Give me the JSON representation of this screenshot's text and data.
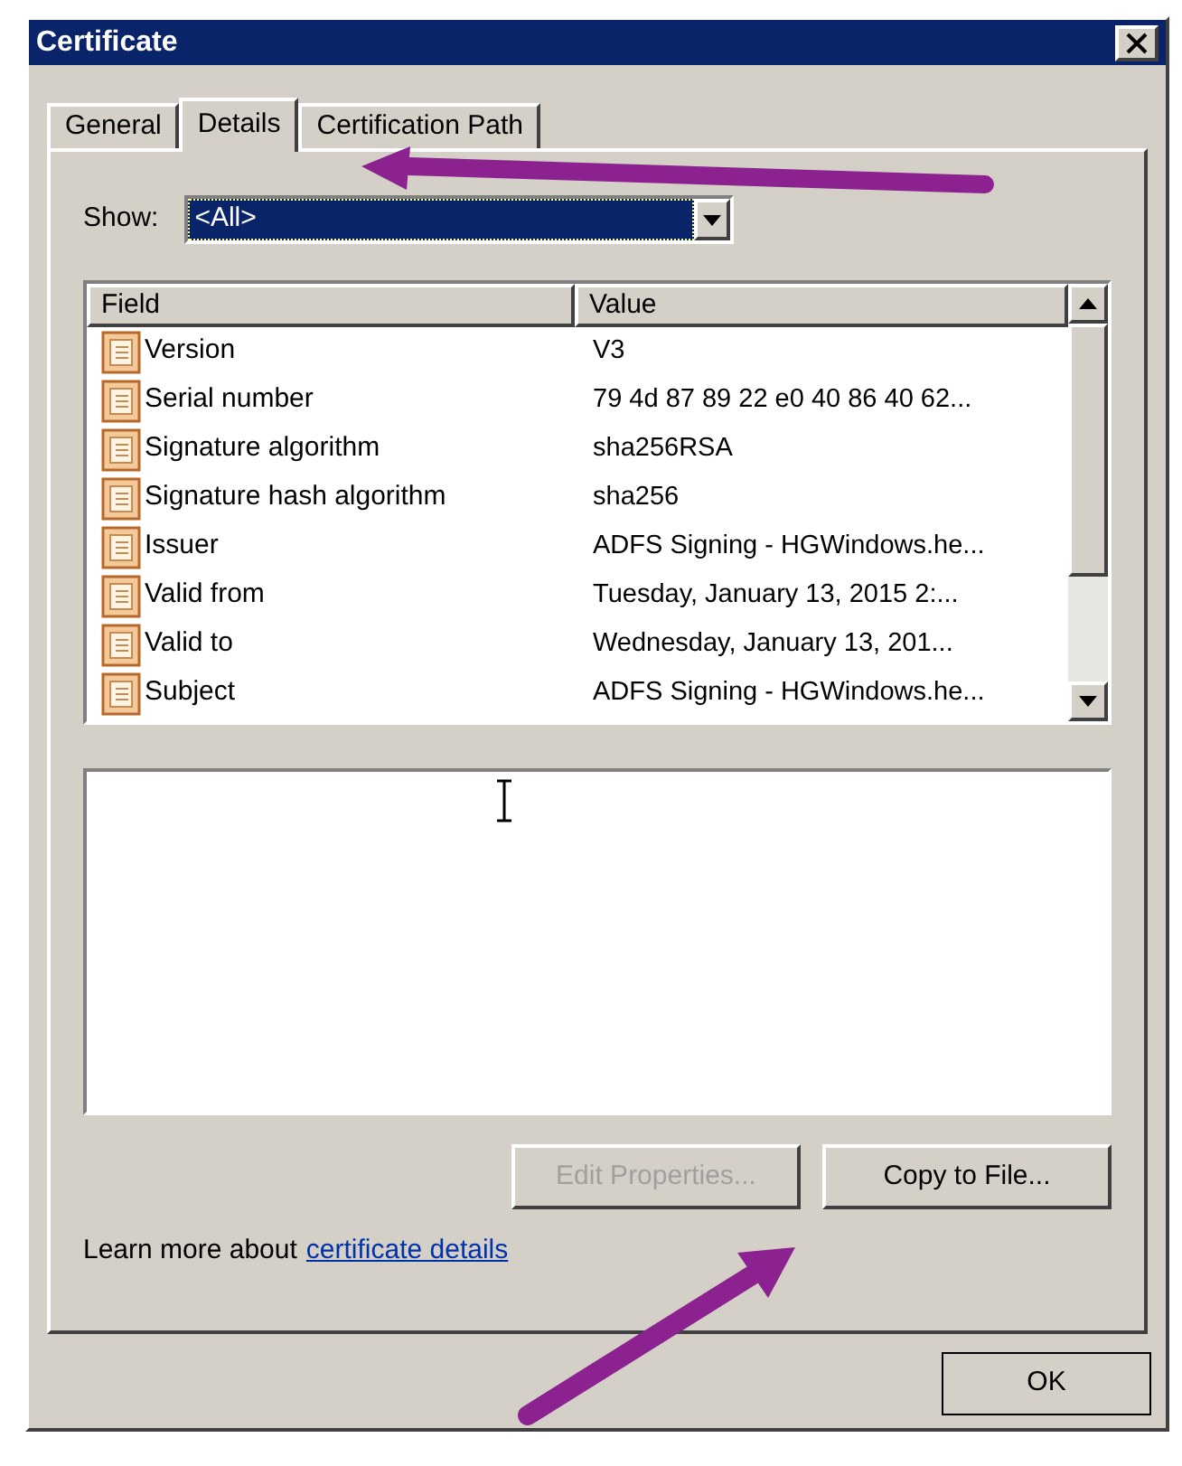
{
  "window": {
    "title": "Certificate"
  },
  "tabs": [
    {
      "label": "General",
      "selected": false
    },
    {
      "label": "Details",
      "selected": true
    },
    {
      "label": "Certification Path",
      "selected": false
    }
  ],
  "show": {
    "label": "Show:",
    "value": "<All>"
  },
  "table": {
    "columns": [
      "Field",
      "Value"
    ],
    "rows": [
      {
        "field": "Version",
        "value": "V3"
      },
      {
        "field": "Serial number",
        "value": "79 4d 87 89 22 e0 40 86 40 62..."
      },
      {
        "field": "Signature algorithm",
        "value": "sha256RSA"
      },
      {
        "field": "Signature hash algorithm",
        "value": "sha256"
      },
      {
        "field": "Issuer",
        "value": "ADFS Signing - HGWindows.he..."
      },
      {
        "field": "Valid from",
        "value": "Tuesday, January 13, 2015 2:..."
      },
      {
        "field": "Valid to",
        "value": "Wednesday, January 13, 201..."
      },
      {
        "field": "Subject",
        "value": "ADFS Signing - HGWindows.he..."
      }
    ]
  },
  "buttons": [
    {
      "label": "Edit Properties...",
      "disabled": true
    },
    {
      "label": "Copy to File...",
      "disabled": false
    }
  ],
  "learn_more": {
    "text": "Learn more about",
    "link": "certificate details"
  },
  "ok": {
    "label": "OK"
  }
}
